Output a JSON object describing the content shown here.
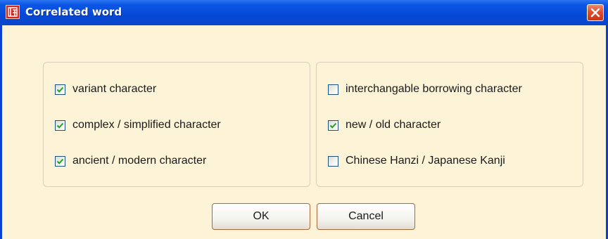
{
  "window": {
    "title": "Correlated word",
    "app_icon": "app-seal-icon",
    "close_icon": "close-icon"
  },
  "options_left": [
    {
      "label": "variant character",
      "checked": true
    },
    {
      "label": "complex / simplified character",
      "checked": true
    },
    {
      "label": "ancient / modern character",
      "checked": true
    }
  ],
  "options_right": [
    {
      "label": "interchangable borrowing character",
      "checked": false
    },
    {
      "label": "new / old character",
      "checked": true
    },
    {
      "label": "Chinese Hanzi / Japanese Kanji",
      "checked": false
    }
  ],
  "buttons": {
    "ok_label": "OK",
    "cancel_label": "Cancel"
  },
  "colors": {
    "titlebar": "#0548d6",
    "dialog_background": "#fdf3d7",
    "checkmark": "#21a121",
    "button_border": "#a8683c"
  }
}
